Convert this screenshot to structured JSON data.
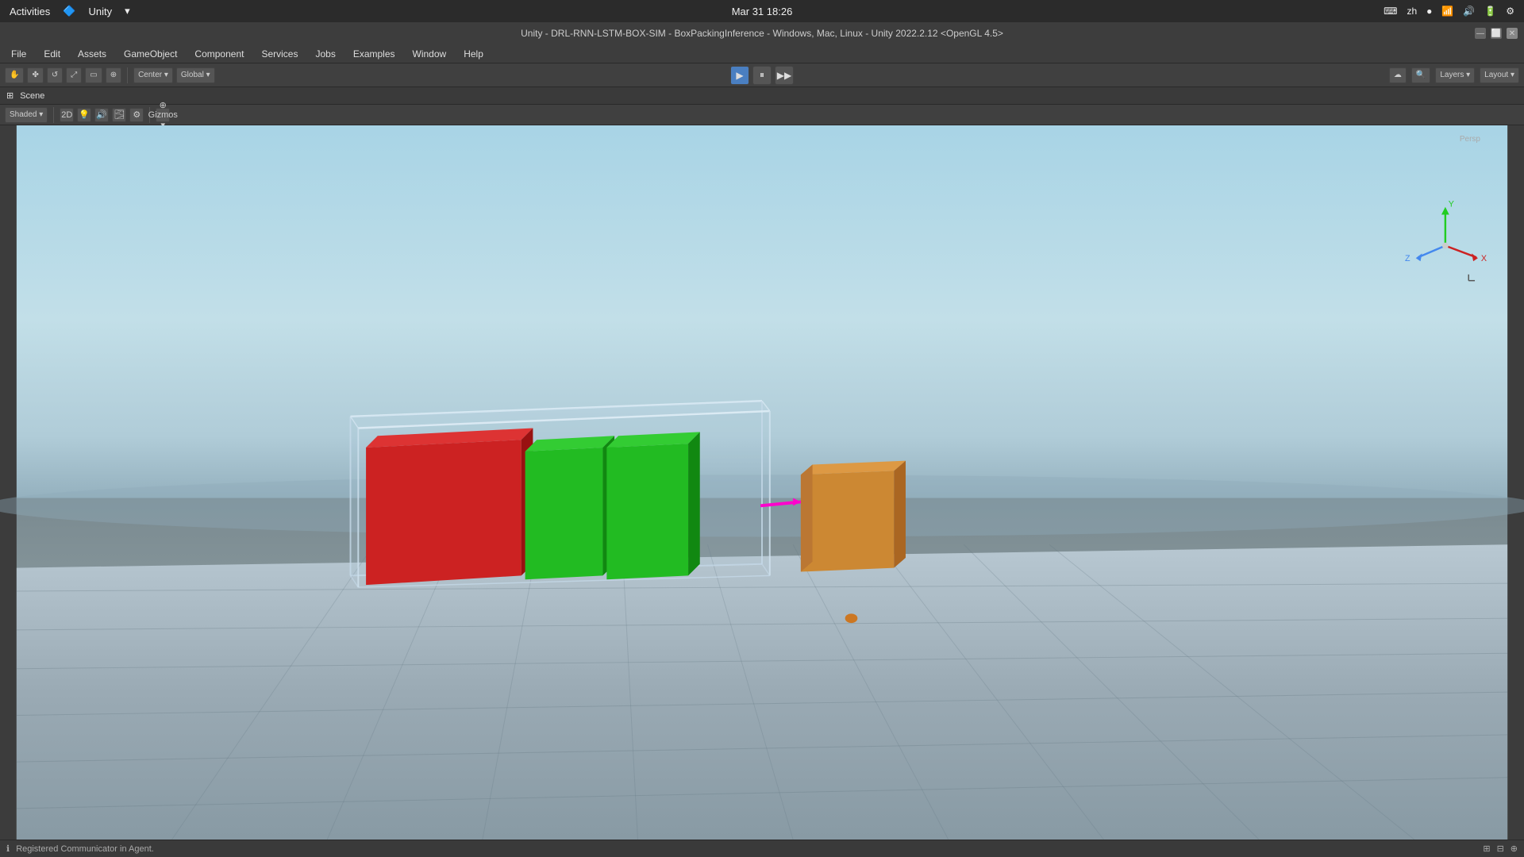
{
  "os_bar": {
    "left": {
      "activities": "Activities",
      "unity": "Unity",
      "dropdown": "▾"
    },
    "center": {
      "datetime": "Mar 31  18:26"
    },
    "right": {
      "icons": [
        "⌨",
        "zh",
        "🔴",
        "📶",
        "🔊",
        "🔋",
        "⚙"
      ]
    }
  },
  "title_bar": {
    "title": "Unity - DRL-RNN-LSTM-BOX-SIM - BoxPackingInference - Windows, Mac, Linux - Unity 2022.2.12 <OpenGL 4.5>",
    "buttons": [
      "—",
      "⬜",
      "✕"
    ]
  },
  "menu_bar": {
    "items": [
      "File",
      "Edit",
      "Assets",
      "GameObject",
      "Component",
      "Services",
      "Jobs",
      "Examples",
      "Window",
      "Help"
    ]
  },
  "toolbar": {
    "center_buttons": [
      "▶",
      "⏸",
      "▶▶"
    ],
    "right": {
      "layers_label": "Layers",
      "layout_label": "Layout"
    }
  },
  "scene_header": {
    "label": "Scene"
  },
  "scene_tools": {
    "pivot_label": "Center",
    "space_label": "Global",
    "grid_icon": "⊞",
    "snap_icon": "⊟",
    "extra_icon": "⊠",
    "hand_tool": "✋",
    "move_tool": "✤",
    "rotate_tool": "↺",
    "scale_tool": "⤢",
    "rect_tool": "▭",
    "transform_tool": "⊕",
    "right_tools": [
      "2D",
      "💡",
      "🔊",
      "🌫",
      "⚙"
    ]
  },
  "status_bar": {
    "icon": "ℹ",
    "message": "Registered Communicator in Agent."
  },
  "gizmo": {
    "x_color": "#e05050",
    "y_color": "#50e050",
    "z_color": "#5050e0",
    "label_x": "X",
    "label_y": "Y",
    "label_z": "Z"
  },
  "colors": {
    "sky_top": "#a8d4e6",
    "sky_bottom": "#8eaab8",
    "ground": "#7a8a90",
    "platform": "#b0bfc8",
    "red_box": "#cc2222",
    "green_box": "#22cc22",
    "orange_box": "#cc8833",
    "magenta_line": "#ff00aa",
    "container": "rgba(200,220,230,0.25)"
  }
}
